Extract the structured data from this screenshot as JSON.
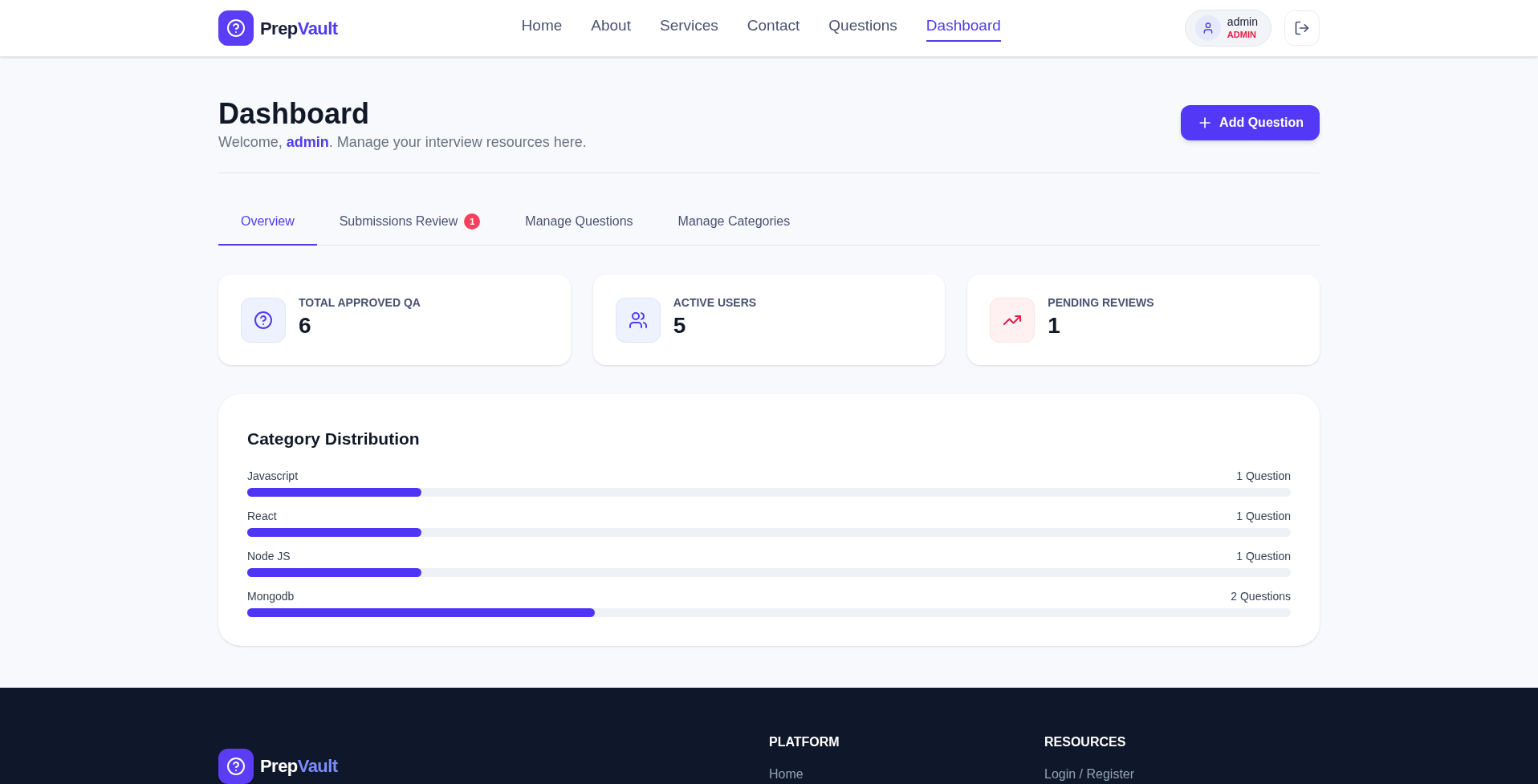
{
  "header": {
    "logo": {
      "part_1": "Prep",
      "part_2": "Vault"
    },
    "nav": [
      {
        "label": "Home",
        "selected": false
      },
      {
        "label": "About",
        "selected": false
      },
      {
        "label": "Services",
        "selected": false
      },
      {
        "label": "Contact",
        "selected": false
      },
      {
        "label": "Questions",
        "selected": false
      },
      {
        "label": "Dashboard",
        "selected": true
      }
    ],
    "user": {
      "name": "admin",
      "role": "ADMIN"
    }
  },
  "page": {
    "title": "Dashboard",
    "welcome": "Welcome, **admin**. Manage your interview resources here.",
    "add_button": "Add Question"
  },
  "tabs": [
    {
      "label": "Overview",
      "selected": true
    },
    {
      "label": "Submissions Review",
      "selected": false,
      "badge": "1"
    },
    {
      "label": "Manage Questions",
      "selected": false
    },
    {
      "label": "Manage Categories",
      "selected": false
    }
  ],
  "stats": [
    {
      "kind": "question",
      "label": "TOTAL APPROVED QA",
      "value": "6"
    },
    {
      "kind": "users",
      "label": "ACTIVE USERS",
      "value": "5"
    },
    {
      "kind": "trend",
      "label": "PENDING REVIEWS",
      "value": "1"
    }
  ],
  "distribution": {
    "title": "Category Distribution",
    "rows": [
      {
        "name": "Javascript",
        "count": "1 Question",
        "level": 0.1667
      },
      {
        "name": "React",
        "count": "1 Question",
        "level": 0.1667
      },
      {
        "name": "Node JS",
        "count": "1 Question",
        "level": 0.1667
      },
      {
        "name": "Mongodb",
        "count": "2 Questions",
        "level": 0.3333
      }
    ]
  },
  "footer": {
    "logo": {
      "part_1": "Prep",
      "part_2": "Vault"
    },
    "columns": [
      {
        "heading": "PLATFORM",
        "links": [
          "Home"
        ]
      },
      {
        "heading": "RESOURCES",
        "links": [
          "Login / Register"
        ]
      }
    ]
  }
}
